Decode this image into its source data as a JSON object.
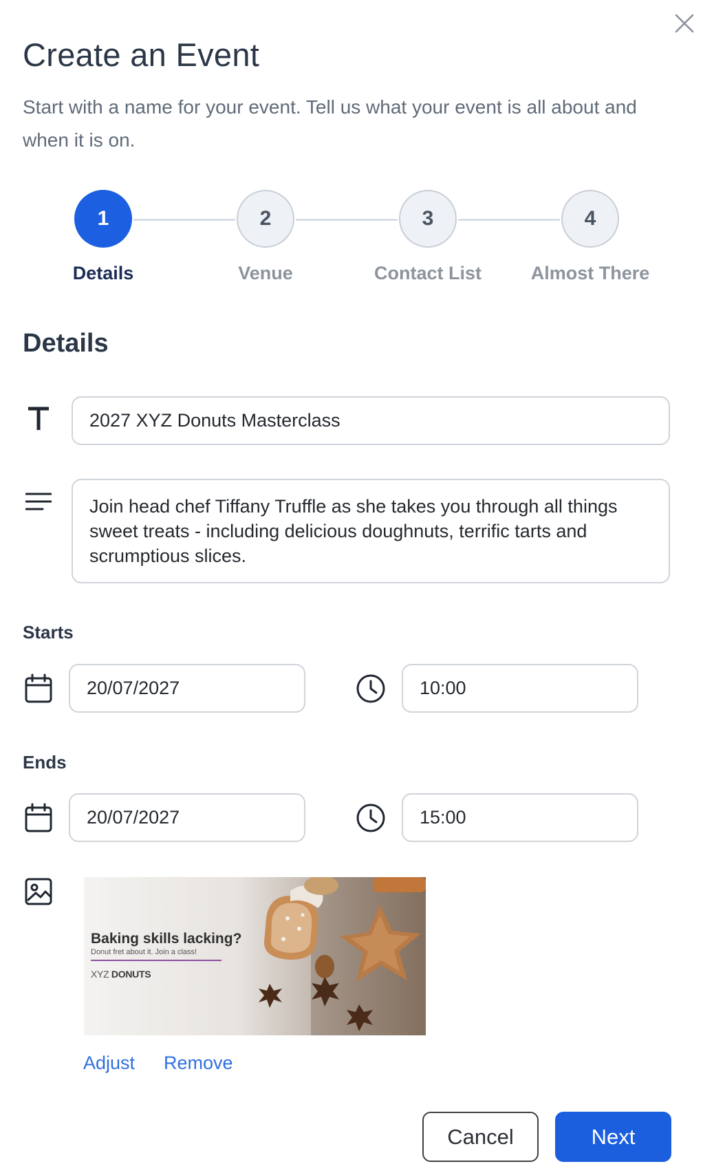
{
  "dialog": {
    "title": "Create an Event",
    "subtitle": "Start with a name for your event. Tell us what your event is all about and when it is on."
  },
  "stepper": {
    "steps": [
      {
        "number": "1",
        "label": "Details",
        "active": true
      },
      {
        "number": "2",
        "label": "Venue",
        "active": false
      },
      {
        "number": "3",
        "label": "Contact List",
        "active": false
      },
      {
        "number": "4",
        "label": "Almost There",
        "active": false
      }
    ]
  },
  "details": {
    "section_title": "Details",
    "event_name": "2027 XYZ Donuts Masterclass",
    "description": "Join head chef Tiffany Truffle as she takes you through all things sweet treats - including delicious doughnuts, terrific tarts and scrumptious slices.",
    "starts_label": "Starts",
    "start_date": "20/07/2027",
    "start_time": "10:00",
    "ends_label": "Ends",
    "end_date": "20/07/2027",
    "end_time": "15:00"
  },
  "image": {
    "headline": "Baking skills lacking?",
    "tagline": "Donut fret about it. Join a class!",
    "brand_prefix": "XYZ",
    "brand_name": "DONUTS",
    "adjust_label": "Adjust",
    "remove_label": "Remove"
  },
  "actions": {
    "cancel_label": "Cancel",
    "next_label": "Next"
  },
  "icons": {
    "close": "close-icon",
    "title": "text-title-icon",
    "description": "text-align-icon",
    "date": "calendar-icon",
    "time": "clock-icon",
    "image": "image-icon"
  },
  "colors": {
    "primary": "#1b5fdf",
    "link": "#2f6fe0",
    "active_step_label": "#1b2c55",
    "inactive_step": "#8d949d"
  }
}
